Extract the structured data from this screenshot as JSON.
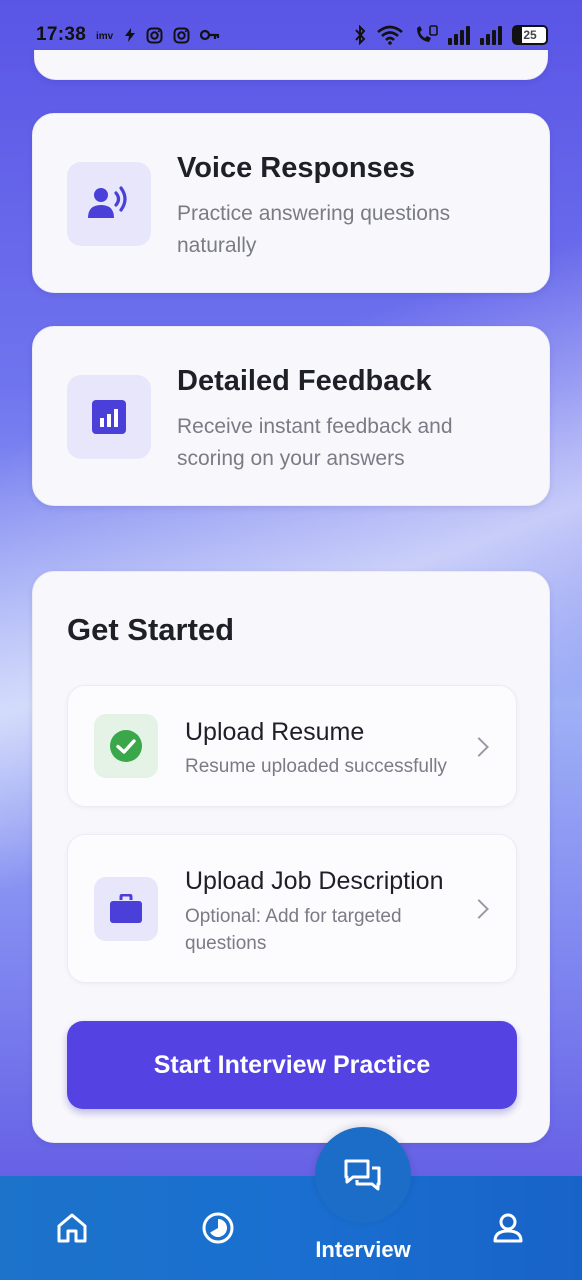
{
  "status_bar": {
    "time": "17:38",
    "left_icons": [
      "imv-icon",
      "flash-icon",
      "instagram-icon",
      "instagram-icon",
      "key-icon"
    ],
    "battery_level": "25"
  },
  "features": [
    {
      "title": "Voice Responses",
      "description": "Practice answering questions naturally",
      "icon": "voice-icon"
    },
    {
      "title": "Detailed Feedback",
      "description": "Receive instant feedback and scoring on your answers",
      "icon": "chart-icon"
    }
  ],
  "get_started": {
    "title": "Get Started",
    "upload_resume": {
      "title": "Upload Resume",
      "subtitle": "Resume uploaded successfully",
      "status": "success"
    },
    "upload_job_description": {
      "title": "Upload Job Description",
      "subtitle": "Optional: Add for targeted questions"
    },
    "start_button": "Start Interview Practice"
  },
  "bottom_nav": {
    "active_label": "Interview",
    "items": [
      "home-icon",
      "stats-icon",
      "interview-icon",
      "profile-icon"
    ]
  },
  "colors": {
    "accent": "#5443e2",
    "nav": "#1c6dc8",
    "success": "#3aa84a"
  }
}
